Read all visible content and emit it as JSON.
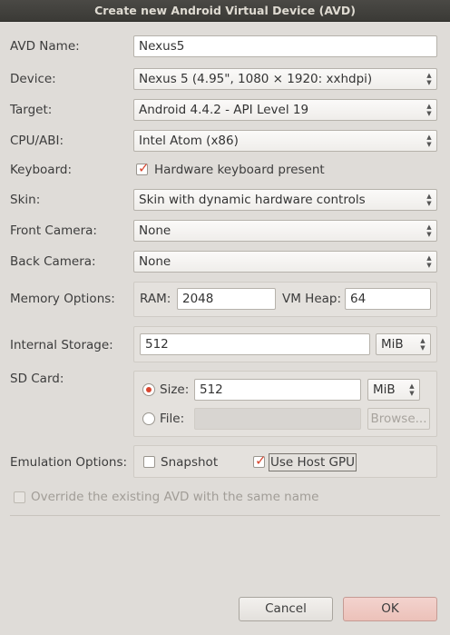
{
  "window": {
    "title": "Create new Android Virtual Device (AVD)"
  },
  "form": {
    "avd_name": {
      "label": "AVD Name:",
      "value": "Nexus5"
    },
    "device": {
      "label": "Device:",
      "value": "Nexus 5 (4.95\", 1080 × 1920: xxhdpi)"
    },
    "target": {
      "label": "Target:",
      "value": "Android 4.4.2 - API Level 19"
    },
    "cpu_abi": {
      "label": "CPU/ABI:",
      "value": "Intel Atom (x86)"
    },
    "keyboard": {
      "label": "Keyboard:",
      "checkbox_label": "Hardware keyboard present",
      "checked": true
    },
    "skin": {
      "label": "Skin:",
      "value": "Skin with dynamic hardware controls"
    },
    "front_camera": {
      "label": "Front Camera:",
      "value": "None"
    },
    "back_camera": {
      "label": "Back Camera:",
      "value": "None"
    },
    "memory": {
      "label": "Memory Options:",
      "ram_label": "RAM:",
      "ram_value": "2048",
      "vm_heap_label": "VM Heap:",
      "vm_heap_value": "64"
    },
    "internal_storage": {
      "label": "Internal Storage:",
      "value": "512",
      "unit": "MiB"
    },
    "sd_card": {
      "label": "SD Card:",
      "size_label": "Size:",
      "size_value": "512",
      "size_unit": "MiB",
      "size_selected": true,
      "file_label": "File:",
      "file_value": "",
      "browse_label": "Browse..."
    },
    "emulation": {
      "label": "Emulation Options:",
      "snapshot_label": "Snapshot",
      "snapshot_checked": false,
      "host_gpu_label": "Use Host GPU",
      "host_gpu_checked": true
    },
    "override": {
      "label": "Override the existing AVD with the same name",
      "checked": false,
      "enabled": false
    }
  },
  "buttons": {
    "cancel": "Cancel",
    "ok": "OK"
  },
  "colors": {
    "accent": "#d8452e",
    "background": "#dfdcd8",
    "titlebar": "#3b3a36"
  }
}
